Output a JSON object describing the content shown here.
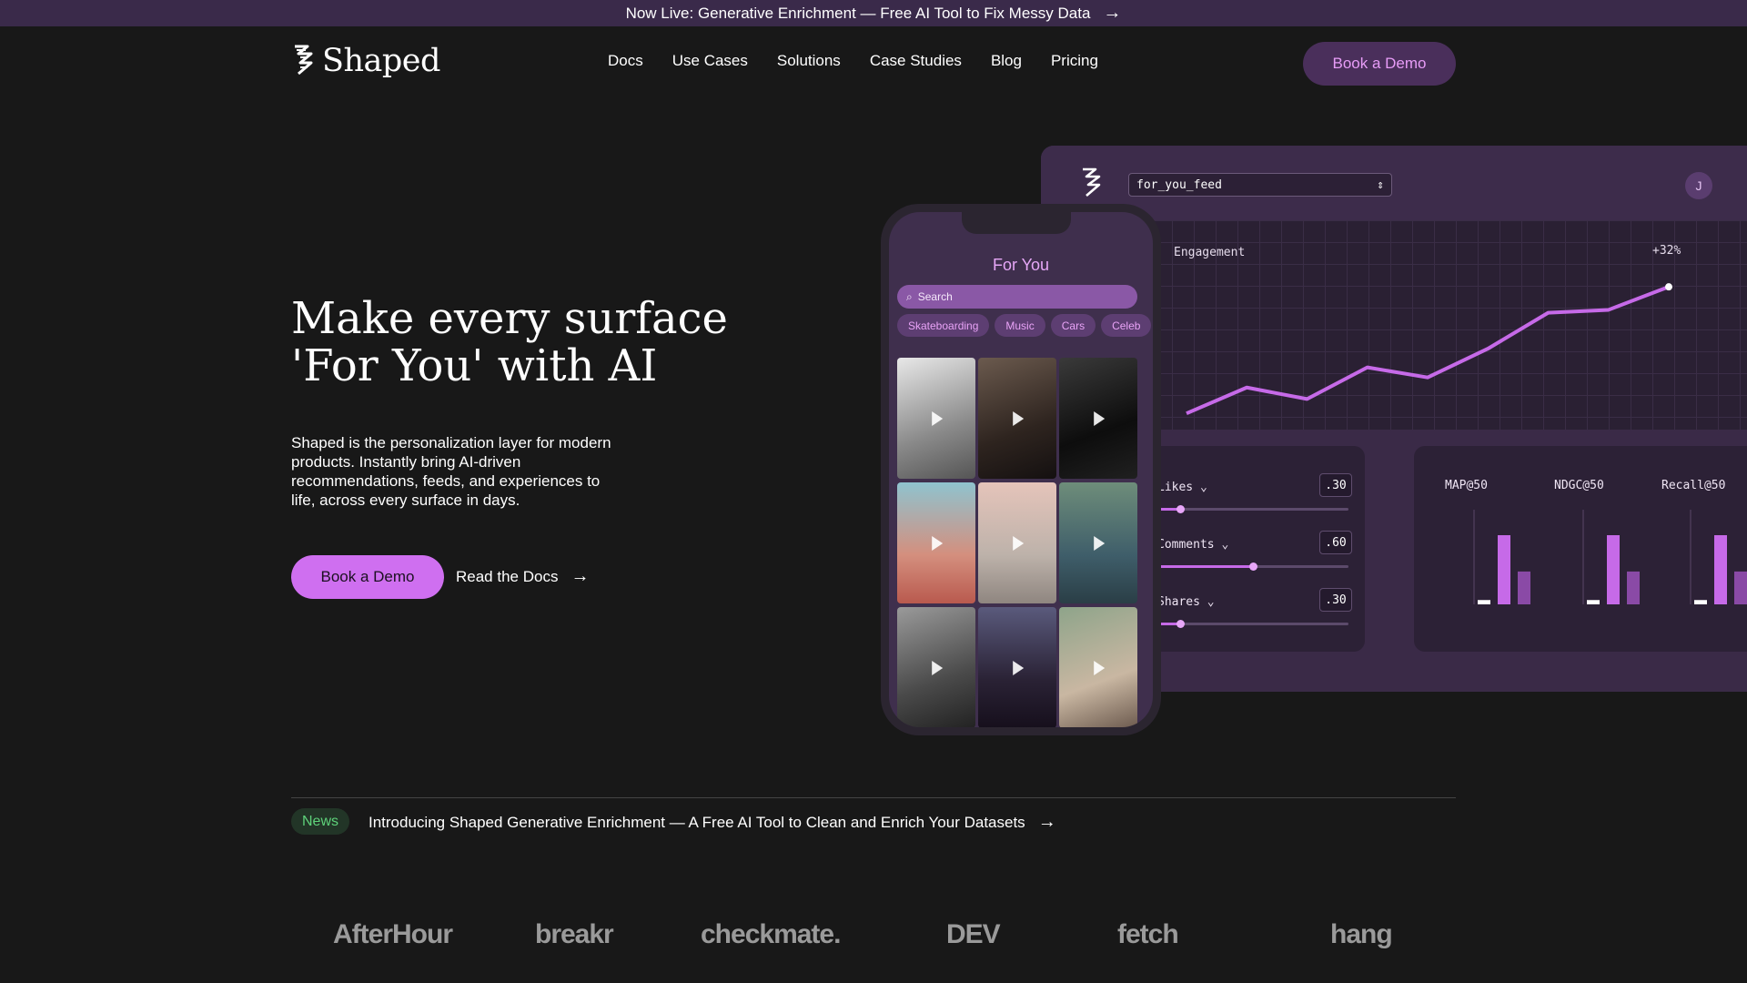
{
  "announcement": {
    "text": "Now Live: Generative Enrichment — Free AI Tool to Fix Messy Data",
    "arrow": "→"
  },
  "nav": {
    "brand": "Shaped",
    "items": [
      "Docs",
      "Use Cases",
      "Solutions",
      "Case Studies",
      "Blog",
      "Pricing"
    ],
    "cta": "Book a Demo"
  },
  "hero": {
    "title": "Make every surface 'For You' with AI",
    "description": "Shaped is the personalization layer for modern products. Instantly bring AI-driven recommendations, feeds, and experiences to life, across every surface in days.",
    "primary_cta": "Book a Demo",
    "secondary_cta": "Read the Docs",
    "arrow": "→"
  },
  "dashboard": {
    "selector_value": "for_you_feed",
    "avatar_initial": "J",
    "chart_label": "Engagement",
    "chart_delta": "+32%",
    "engagement_series": [
      0.1,
      0.28,
      0.2,
      0.42,
      0.35,
      0.55,
      0.8,
      0.82,
      0.98
    ],
    "weights": [
      {
        "label": "Likes",
        "value": ".30",
        "level": 0.12
      },
      {
        "label": "Comments",
        "value": ".60",
        "level": 0.5
      },
      {
        "label": "Shares",
        "value": ".30",
        "level": 0.12
      }
    ],
    "metrics": [
      {
        "name": "MAP@50",
        "bars": [
          0.05,
          0.8,
          0.38
        ]
      },
      {
        "name": "NDGC@50",
        "bars": [
          0.05,
          0.8,
          0.38
        ]
      },
      {
        "name": "Recall@50",
        "bars": [
          0.05,
          0.8,
          0.38
        ]
      }
    ],
    "colors": {
      "accent": "#c66ae8",
      "muted": "#8a4aa6"
    }
  },
  "phone": {
    "title": "For You",
    "search_placeholder": "Search",
    "chips": [
      "Skateboarding",
      "Music",
      "Cars",
      "Celeb"
    ],
    "tiles": [
      {
        "name": "skate-graffiti",
        "bg": "linear-gradient(160deg,#e8e8e8,#8a8a8a 60%,#555)"
      },
      {
        "name": "portrait-woman",
        "bg": "linear-gradient(160deg,#6b5a4e,#2e241f 60%,#141010)"
      },
      {
        "name": "black-car",
        "bg": "linear-gradient(160deg,#3a3a3a,#0d0d0d 60%,#202020)"
      },
      {
        "name": "skate-jump-sky",
        "bg": "linear-gradient(180deg,#8fc3cf,#d48f7e 60%,#b95a4e)"
      },
      {
        "name": "skate-stairs",
        "bg": "linear-gradient(180deg,#e5c4ba,#bdb2aa 60%,#8f8680)"
      },
      {
        "name": "skater-ride",
        "bg": "linear-gradient(180deg,#6e8d7a,#3f5e6a 60%,#2a3e46)"
      },
      {
        "name": "vintage-car",
        "bg": "linear-gradient(160deg,#9a9a9a,#4a4a4a 60%,#222)"
      },
      {
        "name": "night-portrait",
        "bg": "linear-gradient(180deg,#5a5a7c,#2a2235 60%,#160f1c)"
      },
      {
        "name": "selfie-woman",
        "bg": "linear-gradient(160deg,#8ea48a,#c9b7a2 60%,#6d5b4f)"
      }
    ]
  },
  "news": {
    "badge": "News",
    "text": "Introducing Shaped Generative Enrichment — A Free AI Tool to Clean and Enrich Your Datasets",
    "arrow": "→"
  },
  "logos": [
    "AfterHour",
    "breakr",
    "checkmate.",
    "DEV",
    "fetch",
    "hang"
  ]
}
